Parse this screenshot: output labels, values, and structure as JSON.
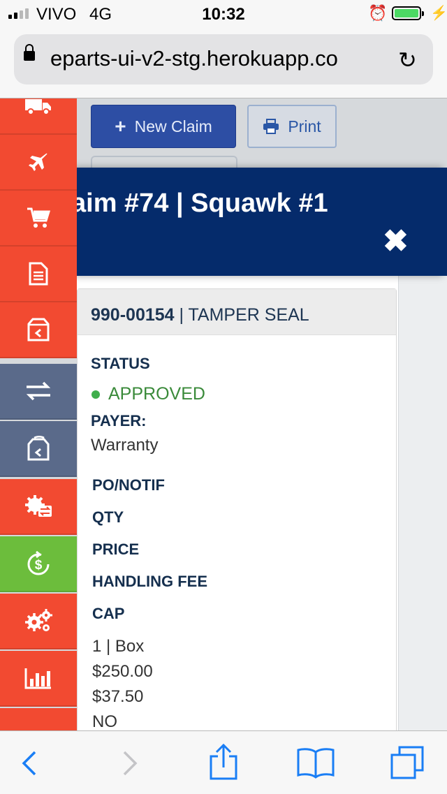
{
  "status_bar": {
    "carrier": "VIVO",
    "network": "4G",
    "time": "10:32",
    "battery_level": 1.0
  },
  "browser": {
    "url": "eparts-ui-v2-stg.herokuapp.co"
  },
  "toolbar": {
    "new_claim_label": "New Claim",
    "print_label": "Print"
  },
  "modal": {
    "title": "aim #74 | Squawk #1",
    "part_number": "990-00154",
    "part_name": "| TAMPER SEAL",
    "status_label": "STATUS",
    "status_value": "APPROVED",
    "status_color": "#3a8a3a",
    "payer_label": "PAYER:",
    "payer_value": "Warranty",
    "po_label": "PO/NOTIF",
    "qty_label": "QTY",
    "price_label": "PRICE",
    "handling_fee_label": "HANDLING FEE",
    "cap_label": "CAP",
    "qty_value": "1 | Box",
    "price_value": "$250.00",
    "handling_fee_value": "$37.50",
    "cap_value": "NO"
  },
  "sidebar": {
    "items": [
      {
        "icon": "truck-icon",
        "color": "#f24a31"
      },
      {
        "icon": "airplane-icon",
        "color": "#f24a31"
      },
      {
        "icon": "cart-icon",
        "color": "#f24a31"
      },
      {
        "icon": "document-icon",
        "color": "#f24a31"
      },
      {
        "icon": "box-return-icon",
        "color": "#f24a31"
      },
      {
        "icon": "transfer-arrows-icon",
        "color": "#5a6a8a"
      },
      {
        "icon": "box-exchange-icon",
        "color": "#5a6a8a"
      },
      {
        "icon": "gear-exchange-icon",
        "color": "#f24a31"
      },
      {
        "icon": "dollar-refresh-icon",
        "color": "#6cbd3c"
      },
      {
        "icon": "gears-icon",
        "color": "#f24a31"
      },
      {
        "icon": "bar-chart-icon",
        "color": "#f24a31"
      }
    ]
  }
}
